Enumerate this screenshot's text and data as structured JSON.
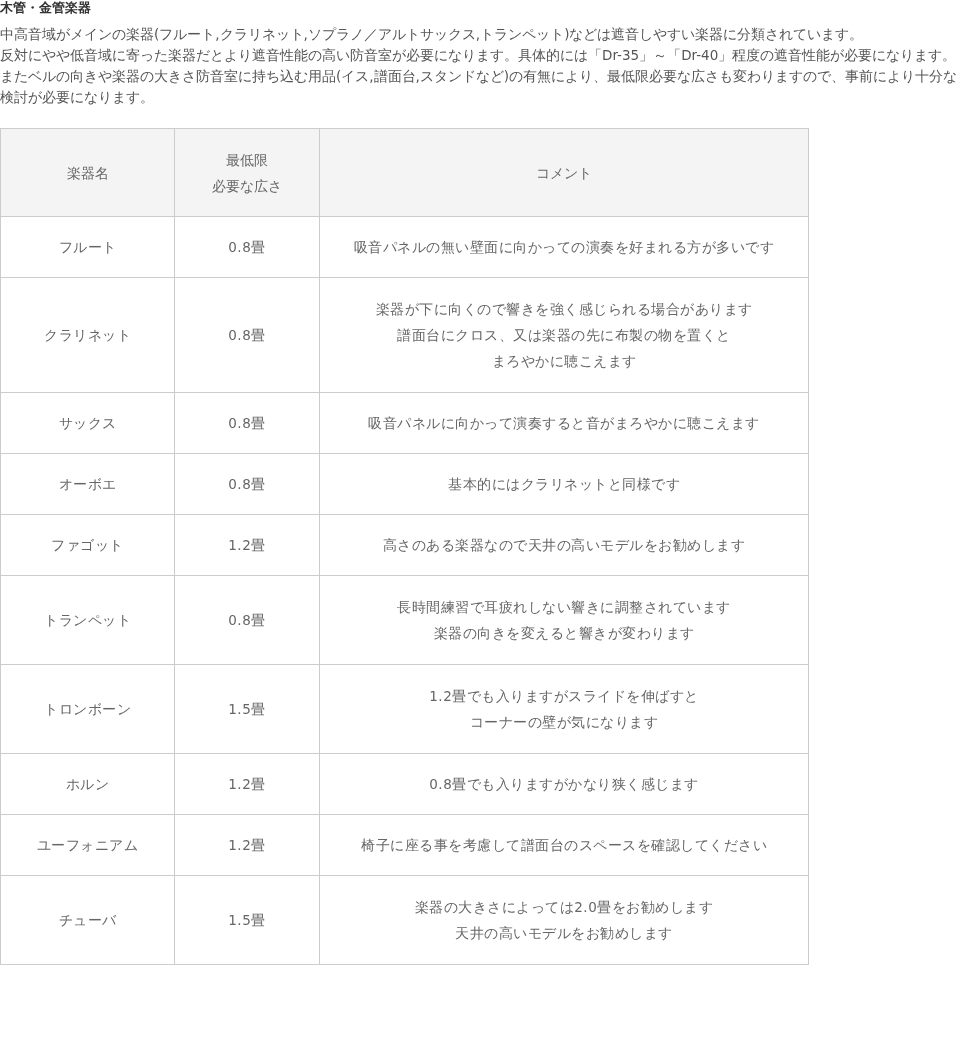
{
  "heading": "木管・金管楽器",
  "paragraphs": [
    "中高音域がメインの楽器(フルート,クラリネット,ソプラノ／アルトサックス,トランペット)などは遮音しやすい楽器に分類されています。",
    "反対にやや低音域に寄った楽器だとより遮音性能の高い防音室が必要になります。具体的には「Dr-35」～「Dr-40」程度の遮音性能が必要になります。またベルの向きや楽器の大きさ防音室に持ち込む用品(イス,譜面台,スタンドなど)の有無により、最低限必要な広さも変わりますので、事前により十分な検討が必要になります。"
  ],
  "table": {
    "columns": [
      "楽器名",
      [
        "最低限",
        "必要な広さ"
      ],
      "コメント"
    ],
    "rows": [
      [
        "フルート",
        "0.8畳",
        "吸音パネルの無い壁面に向かっての演奏を好まれる方が多いです"
      ],
      [
        "クラリネット",
        "0.8畳",
        [
          "楽器が下に向くので響きを強く感じられる場合があります",
          "譜面台にクロス、又は楽器の先に布製の物を置くと",
          "まろやかに聴こえます"
        ]
      ],
      [
        "サックス",
        "0.8畳",
        "吸音パネルに向かって演奏すると音がまろやかに聴こえます"
      ],
      [
        "オーボエ",
        "0.8畳",
        "基本的にはクラリネットと同様です"
      ],
      [
        "ファゴット",
        "1.2畳",
        "高さのある楽器なので天井の高いモデルをお勧めします"
      ],
      [
        "トランペット",
        "0.8畳",
        [
          "長時間練習で耳疲れしない響きに調整されています",
          "楽器の向きを変えると響きが変わります"
        ]
      ],
      [
        "トロンボーン",
        "1.5畳",
        [
          "1.2畳でも入りますがスライドを伸ばすと",
          "コーナーの壁が気になります"
        ]
      ],
      [
        "ホルン",
        "1.2畳",
        "0.8畳でも入りますがかなり狭く感じます"
      ],
      [
        "ユーフォニアム",
        "1.2畳",
        "椅子に座る事を考慮して譜面台のスペースを確認してください"
      ],
      [
        "チューバ",
        "1.5畳",
        [
          "楽器の大きさによっては2.0畳をお勧めします",
          "天井の高いモデルをお勧めします"
        ]
      ]
    ]
  }
}
